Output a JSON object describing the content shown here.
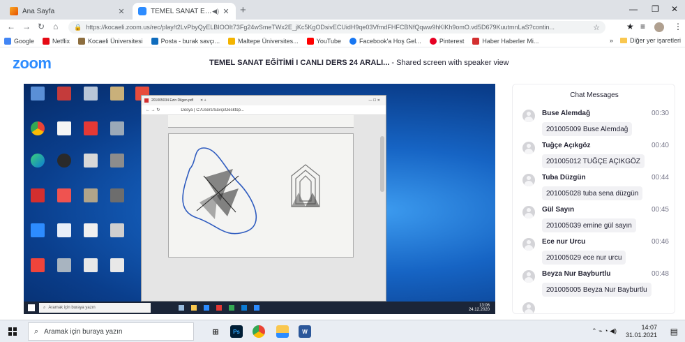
{
  "browser": {
    "tabs": [
      {
        "title": "Ana Sayfa",
        "active": false
      },
      {
        "title": "TEMEL SANAT EĞİTİMİ I CAN",
        "active": true
      }
    ],
    "url": "https://kocaeli.zoom.us/rec/play/t2LvPbyQyELBIOOIt73Fg24wSmeTWx2E_jKc5KgODsivECUidH9qe03VfmdFHFCBNfQqww9hKlKh9omO.vd5D679KuutmnLaS?contin...",
    "bookmarks": [
      {
        "label": "Google",
        "color": "#4285f4"
      },
      {
        "label": "Netflix",
        "color": "#e50914"
      },
      {
        "label": "Kocaeli Üniversitesi",
        "color": "#8d6e3f"
      },
      {
        "label": "Posta - burak savçı...",
        "color": "#0f6cbd"
      },
      {
        "label": "Maltepe Üniversites...",
        "color": "#f4b400"
      },
      {
        "label": "YouTube",
        "color": "#ff0000"
      },
      {
        "label": "Facebook'a Hoş Gel...",
        "color": "#1877f2"
      },
      {
        "label": "Pinterest",
        "color": "#e60023"
      },
      {
        "label": "Haber Haberler Mi...",
        "color": "#d32f2f"
      }
    ],
    "other_bookmarks": "Diğer yer işaretleri"
  },
  "zoom": {
    "logo": "zoom",
    "meeting_title": "TEMEL SANAT EĞİTİMİ I CANLI DERS 24 ARALI...",
    "meeting_subtitle": " - Shared screen with speaker view"
  },
  "remote": {
    "edge_tab": "201005034 Ezin Dilgen.pdf",
    "edge_address": "Dosya  |  C:/Users/Savçı/Desktop...",
    "search_placeholder": "Aramak için buraya yazın",
    "tray_time": "13:06",
    "tray_date": "24.12.2020"
  },
  "chat": {
    "title": "Chat Messages",
    "messages": [
      {
        "name": "Buse Alemdağ",
        "time": "00:30",
        "text": "201005009 Buse Alemdağ"
      },
      {
        "name": "Tuğçe Açıkgöz",
        "time": "00:40",
        "text": "201005012 TUĞÇE AÇIKGÖZ"
      },
      {
        "name": "Tuba Düzgün",
        "time": "00:44",
        "text": "201005028 tuba sena düzgün"
      },
      {
        "name": "Gül Sayın",
        "time": "00:45",
        "text": "201005039 emine gül sayın"
      },
      {
        "name": "Ece nur Urcu",
        "time": "00:46",
        "text": "201005029 ece nur urcu"
      },
      {
        "name": "Beyza Nur Bayburtlu",
        "time": "00:48",
        "text": "201005005 Beyza Nur Bayburtlu"
      }
    ]
  },
  "taskbar": {
    "search_placeholder": "Aramak için buraya yazın",
    "time": "14:07",
    "date": "31.01.2021",
    "apps": [
      {
        "icon": "task-view-icon",
        "label": "⊞"
      },
      {
        "icon": "photoshop-icon",
        "label": "Ps"
      },
      {
        "icon": "chrome-icon",
        "label": ""
      },
      {
        "icon": "file-explorer-icon",
        "label": ""
      },
      {
        "icon": "word-icon",
        "label": "W"
      }
    ]
  }
}
